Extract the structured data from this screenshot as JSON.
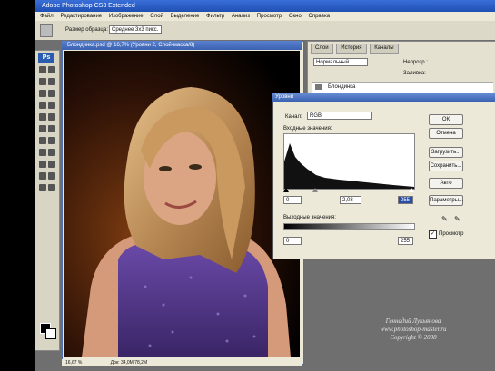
{
  "app": {
    "title": "Adobe Photoshop CS3 Extended"
  },
  "menu": [
    "Файл",
    "Редактирование",
    "Изображение",
    "Слой",
    "Выделение",
    "Фильтр",
    "Анализ",
    "Просмотр",
    "Окно",
    "Справка"
  ],
  "options": {
    "sample_label": "Размер образца:",
    "sample_value": "Среднее 3x3 пикс."
  },
  "document": {
    "title": "Блондинка.psd @ 16,7% (Уровни 2, Слой-маска/8)",
    "zoom": "16,67 %",
    "doc_info": "Док: 34,0М/78,2М"
  },
  "panel": {
    "tabs": [
      "Слои",
      "История",
      "Каналы"
    ],
    "blend_mode": "Нормальный",
    "opacity_label": "Непрозр.:",
    "fill_label": "Заливка:",
    "layer_name": "Блондинка"
  },
  "levels": {
    "title": "Уровни",
    "channel_label": "Канал:",
    "channel_value": "RGB",
    "input_label": "Входные значения:",
    "input_values": [
      "0",
      "2,08",
      "255"
    ],
    "output_label": "Выходные значения:",
    "output_values": [
      "0",
      "255"
    ],
    "buttons": [
      "ОК",
      "Отмена",
      "Загрузить...",
      "Сохранить...",
      "Авто",
      "Параметры..."
    ],
    "preview_label": "Просмотр",
    "preview_checked": true
  },
  "signature": {
    "line1": "Геннадий Лукьянова",
    "line2": "www.photoshop-master.ru",
    "line3": "Copyright © 2008"
  }
}
